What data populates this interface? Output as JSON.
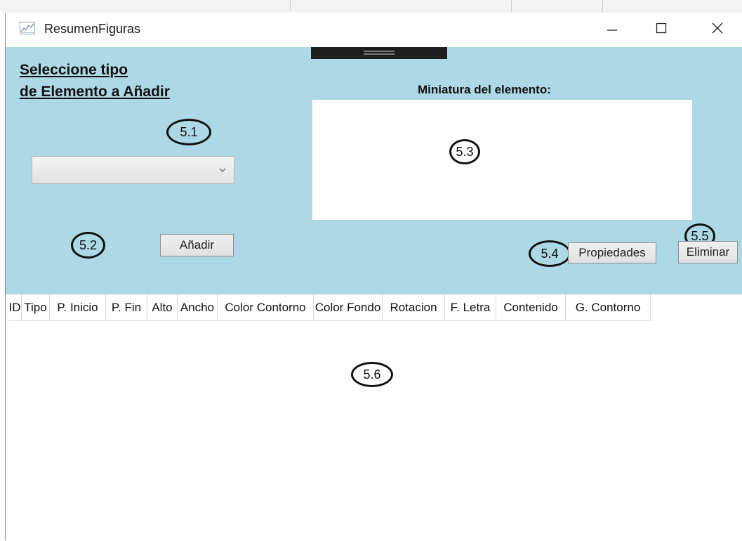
{
  "window": {
    "title": "ResumenFiguras"
  },
  "panel": {
    "heading_line1": "Seleccione tipo",
    "heading_line2": "de Elemento a Añadir",
    "element_type_selected": "",
    "add_label": "Añadir",
    "preview_label": "Miniatura del elemento:",
    "properties_label": "Propiedades",
    "delete_label": "Eliminar"
  },
  "grid": {
    "columns": [
      "ID",
      "Tipo",
      "P. Inicio",
      "P. Fin",
      "Alto",
      "Ancho",
      "Color Contorno",
      "Color Fondo",
      "Rotacion",
      "F. Letra",
      "Contenido",
      "G. Contorno"
    ],
    "rows": []
  },
  "annotations": {
    "a1": "5.1",
    "a2": "5.2",
    "a3": "5.3",
    "a4": "5.4",
    "a5": "5.5",
    "a6": "5.6"
  },
  "icons": {
    "app": "app-chart-icon",
    "minimize": "minimize-icon",
    "maximize": "maximize-icon",
    "close": "close-icon",
    "chevron": "chevron-down-icon"
  },
  "colors": {
    "panel_bg": "#add8e6",
    "button_bg": "#e1e1e1"
  }
}
